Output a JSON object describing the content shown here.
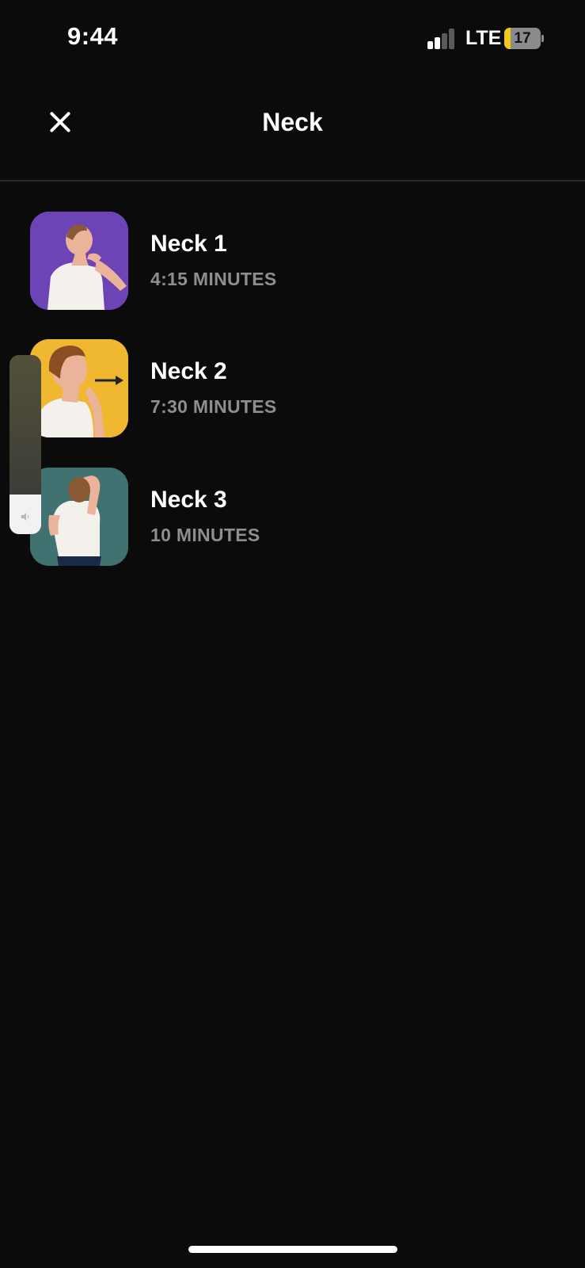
{
  "status_bar": {
    "time": "9:44",
    "network": "LTE",
    "battery_level": "17",
    "battery_fraction": 0.17,
    "signal_bars_active": 2,
    "signal_bars_total": 4
  },
  "header": {
    "title": "Neck",
    "close_icon": "close-icon"
  },
  "exercises": [
    {
      "title": "Neck 1",
      "duration": "4:15 MINUTES",
      "thumb_color": "#6d44b5",
      "icon": "neck-tilt-illustration"
    },
    {
      "title": "Neck 2",
      "duration": "7:30 MINUTES",
      "thumb_color": "#efb830",
      "icon": "chin-tuck-illustration"
    },
    {
      "title": "Neck 3",
      "duration": "10 MINUTES",
      "thumb_color": "#3f7270",
      "icon": "arm-stretch-illustration"
    }
  ],
  "volume_overlay": {
    "level_fraction": 0.22,
    "icon": "speaker-icon"
  },
  "colors": {
    "background": "#0b0b0b",
    "text_primary": "#ffffff",
    "text_secondary": "#8e8e8e",
    "battery_accent": "#f2c818"
  }
}
